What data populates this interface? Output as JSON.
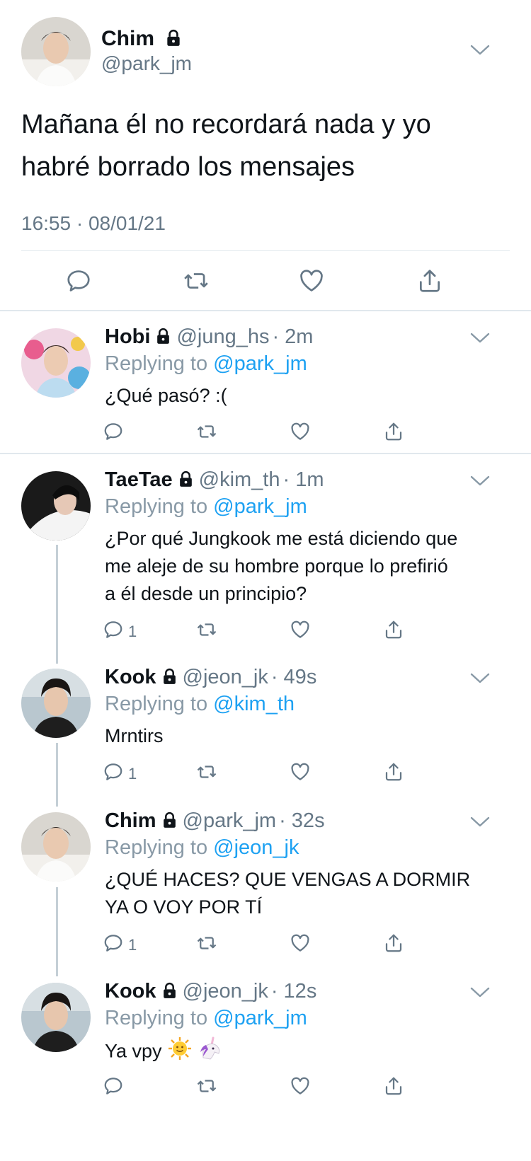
{
  "main_tweet": {
    "name": "Chim",
    "handle": "@park_jm",
    "text_lines": [
      "Mañana él no recordará nada y yo",
      "habré borrado los mensajes"
    ],
    "timestamp": "16:55 · 08/01/21"
  },
  "replies": [
    {
      "name": "Hobi",
      "handle": "@jung_hs",
      "time": "· 2m",
      "replying_prefix": "Replying to",
      "replying_to": "@park_jm",
      "text_lines": [
        "¿Qué pasó? :("
      ],
      "reply_count": ""
    },
    {
      "name": "TaeTae",
      "handle": "@kim_th",
      "time": "· 1m",
      "replying_prefix": "Replying to",
      "replying_to": "@park_jm",
      "text_lines": [
        "¿Por qué Jungkook me está diciendo que",
        "me aleje de su hombre porque lo prefirió",
        "a él desde un principio?"
      ],
      "reply_count": "1"
    },
    {
      "name": "Kook",
      "handle": "@jeon_jk",
      "time": "· 49s",
      "replying_prefix": "Replying to",
      "replying_to": "@kim_th",
      "text_lines": [
        "Mrntirs"
      ],
      "reply_count": "1"
    },
    {
      "name": "Chim",
      "handle": "@park_jm",
      "time": "· 32s",
      "replying_prefix": "Replying to",
      "replying_to": "@jeon_jk",
      "text_lines": [
        "¿QUÉ HACES? QUE VENGAS A DORMIR",
        "YA O VOY POR TÍ"
      ],
      "reply_count": "1"
    },
    {
      "name": "Kook",
      "handle": "@jeon_jk",
      "time": "· 12s",
      "replying_prefix": "Replying to",
      "replying_to": "@park_jm",
      "text_lines": [
        "Ya vpy"
      ],
      "text_emoji": [
        "sun-with-face-emoji",
        "unicorn-emoji"
      ],
      "reply_count": ""
    }
  ],
  "icons": {
    "reply": "speech-bubble-icon",
    "retweet": "retweet-icon",
    "like": "heart-icon",
    "share": "share-icon",
    "lock": "lock-icon",
    "menu": "chevron-down-icon"
  },
  "colors": {
    "link": "#1da1f2",
    "secondary_text": "#657786",
    "icon": "#657786",
    "divider": "#e1e8ed",
    "thread_line": "#c4cfd6"
  }
}
